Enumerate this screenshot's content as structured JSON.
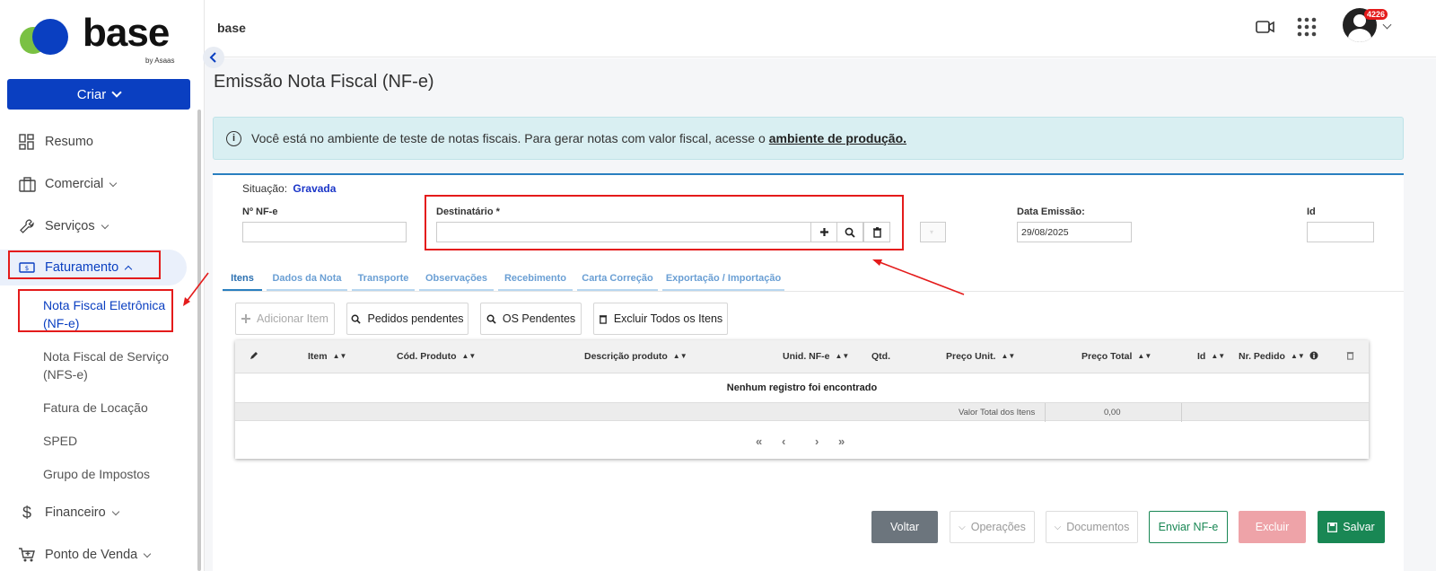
{
  "sidebar": {
    "logo": {
      "word": "base",
      "by": "by Asaas"
    },
    "create_label": "Criar",
    "items": [
      {
        "label": "Resumo"
      },
      {
        "label": "Comercial"
      },
      {
        "label": "Serviços"
      },
      {
        "label": "Faturamento"
      },
      {
        "label": "Financeiro"
      },
      {
        "label": "Ponto de Venda"
      }
    ],
    "subitems": [
      {
        "label": "Nota Fiscal Eletrônica (NF-e)"
      },
      {
        "label": "Nota Fiscal de Serviço (NFS-e)"
      },
      {
        "label": "Fatura de Locação"
      },
      {
        "label": "SPED"
      },
      {
        "label": "Grupo de Impostos"
      }
    ]
  },
  "topbar": {
    "title": "base",
    "notification_count": "4226",
    "icons": [
      "video-icon",
      "apps-grid-icon",
      "avatar"
    ]
  },
  "page": {
    "title": "Emissão Nota Fiscal (NF-e)",
    "alert_text": "Você está no ambiente de teste de notas fiscais. Para gerar notas com valor fiscal, acesse o",
    "alert_link": "ambiente de produção."
  },
  "form": {
    "status_label": "Situação:",
    "status_value": "Gravada",
    "nfe_number_label": "Nº NF-e",
    "nfe_number_value": "",
    "recipient_label": "Destinatário *",
    "recipient_value": "",
    "issue_date_label": "Data Emissão:",
    "issue_date_value": "29/08/2025",
    "id_label": "Id",
    "id_value": ""
  },
  "tabs": [
    {
      "label": "Itens",
      "active": true
    },
    {
      "label": "Dados da Nota"
    },
    {
      "label": "Transporte"
    },
    {
      "label": "Observações"
    },
    {
      "label": "Recebimento"
    },
    {
      "label": "Carta Correção"
    },
    {
      "label": "Exportação / Importação"
    }
  ],
  "actions": {
    "add_item": "Adicionar Item",
    "pending_orders": "Pedidos pendentes",
    "pending_os": "OS Pendentes",
    "delete_all": "Excluir Todos os Itens"
  },
  "table": {
    "columns": [
      "Item",
      "Cód. Produto",
      "Descrição produto",
      "Unid. NF-e",
      "Qtd.",
      "Preço Unit.",
      "Preço Total",
      "Id",
      "Nr. Pedido"
    ],
    "empty_message": "Nenhum registro foi encontrado",
    "total_label": "Valor Total dos Itens",
    "total_value": "0,00"
  },
  "footer": {
    "back": "Voltar",
    "operations": "Operações",
    "documents": "Documentos",
    "send": "Enviar NF-e",
    "delete": "Excluir",
    "save": "Salvar"
  },
  "colors": {
    "primary": "#0a3fc1",
    "accent_tab": "#2a7fc0",
    "alert_bg": "#d9eff2",
    "back_button": "#6c757d",
    "delete_button": "#eea3a8",
    "save_button": "#198754",
    "highlight": "#e41b1b"
  }
}
